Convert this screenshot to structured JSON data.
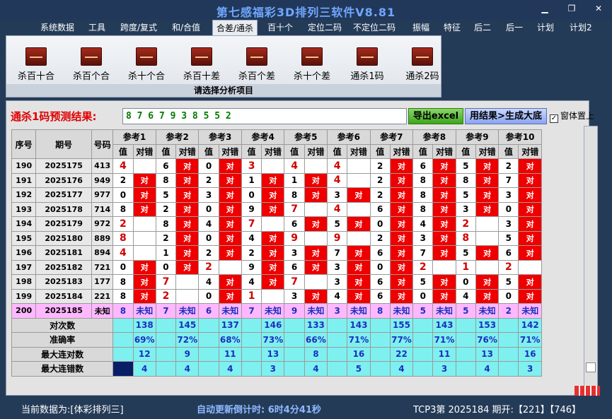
{
  "window": {
    "title": "第七感福彩3D排列三软件V8.81"
  },
  "menu": [
    "系统数据",
    "工具",
    "跨度/复式",
    "和/合值",
    "合差/通杀",
    "百十个",
    "定位二码",
    "不定位二码",
    "振幅",
    "特征",
    "后二",
    "后一",
    "计划",
    "计划2"
  ],
  "menu_active_index": 4,
  "ribbon": {
    "buttons": [
      "杀百十合",
      "杀百个合",
      "杀十个合",
      "杀百十差",
      "杀百个差",
      "杀十个差",
      "通杀1码",
      "通杀2码"
    ],
    "caption": "请选择分析项目"
  },
  "prediction": {
    "label": "通杀1码预测结果:",
    "value": "8 7 6 7 9 3 8 5 5 2"
  },
  "buttons": {
    "excel": "导出excel",
    "generate": "用结果>生成大底",
    "ontop": "窗体置上",
    "ontop_checked": "✓"
  },
  "table": {
    "headers": {
      "seq": "序号",
      "period": "期号",
      "number": "号码",
      "val": "值",
      "result": "对错"
    },
    "refs": [
      "参考1",
      "参考2",
      "参考3",
      "参考4",
      "参考5",
      "参考6",
      "参考7",
      "参考8",
      "参考9",
      "参考10"
    ],
    "rows": [
      {
        "seq": "190",
        "period": "2025175",
        "num": "413",
        "cells": [
          [
            "4",
            0
          ],
          [
            "6",
            1
          ],
          [
            "0",
            1
          ],
          [
            "3",
            0
          ],
          [
            "4",
            0
          ],
          [
            "4",
            0
          ],
          [
            "2",
            1
          ],
          [
            "6",
            1
          ],
          [
            "5",
            1
          ],
          [
            "2",
            1
          ]
        ]
      },
      {
        "seq": "191",
        "period": "2025176",
        "num": "949",
        "cells": [
          [
            "2",
            1
          ],
          [
            "8",
            1
          ],
          [
            "2",
            1
          ],
          [
            "1",
            1
          ],
          [
            "1",
            1
          ],
          [
            "4",
            0
          ],
          [
            "2",
            1
          ],
          [
            "8",
            1
          ],
          [
            "8",
            1
          ],
          [
            "7",
            1
          ]
        ]
      },
      {
        "seq": "192",
        "period": "2025177",
        "num": "977",
        "cells": [
          [
            "0",
            1
          ],
          [
            "5",
            1
          ],
          [
            "3",
            1
          ],
          [
            "0",
            1
          ],
          [
            "8",
            1
          ],
          [
            "3",
            1
          ],
          [
            "2",
            1
          ],
          [
            "8",
            1
          ],
          [
            "5",
            1
          ],
          [
            "3",
            1
          ]
        ]
      },
      {
        "seq": "193",
        "period": "2025178",
        "num": "714",
        "cells": [
          [
            "8",
            1
          ],
          [
            "2",
            1
          ],
          [
            "0",
            1
          ],
          [
            "9",
            1
          ],
          [
            "7",
            0
          ],
          [
            "4",
            0
          ],
          [
            "6",
            1
          ],
          [
            "8",
            1
          ],
          [
            "3",
            1
          ],
          [
            "0",
            1
          ]
        ]
      },
      {
        "seq": "194",
        "period": "2025179",
        "num": "972",
        "cells": [
          [
            "2",
            0
          ],
          [
            "8",
            1
          ],
          [
            "4",
            1
          ],
          [
            "7",
            0
          ],
          [
            "6",
            1
          ],
          [
            "5",
            1
          ],
          [
            "0",
            1
          ],
          [
            "4",
            1
          ],
          [
            "2",
            0
          ],
          [
            "3",
            1
          ]
        ]
      },
      {
        "seq": "195",
        "period": "2025180",
        "num": "889",
        "cells": [
          [
            "8",
            0
          ],
          [
            "2",
            1
          ],
          [
            "0",
            1
          ],
          [
            "4",
            1
          ],
          [
            "9",
            0
          ],
          [
            "9",
            0
          ],
          [
            "2",
            1
          ],
          [
            "3",
            1
          ],
          [
            "8",
            0
          ],
          [
            "5",
            1
          ]
        ]
      },
      {
        "seq": "196",
        "period": "2025181",
        "num": "894",
        "cells": [
          [
            "4",
            0
          ],
          [
            "1",
            1
          ],
          [
            "2",
            1
          ],
          [
            "2",
            1
          ],
          [
            "3",
            1
          ],
          [
            "7",
            1
          ],
          [
            "6",
            1
          ],
          [
            "7",
            1
          ],
          [
            "5",
            1
          ],
          [
            "6",
            1
          ]
        ]
      },
      {
        "seq": "197",
        "period": "2025182",
        "num": "721",
        "cells": [
          [
            "0",
            1
          ],
          [
            "0",
            1
          ],
          [
            "2",
            0
          ],
          [
            "9",
            1
          ],
          [
            "6",
            1
          ],
          [
            "3",
            1
          ],
          [
            "0",
            1
          ],
          [
            "2",
            0
          ],
          [
            "1",
            0
          ],
          [
            "2",
            0
          ]
        ]
      },
      {
        "seq": "198",
        "period": "2025183",
        "num": "177",
        "cells": [
          [
            "8",
            1
          ],
          [
            "7",
            0
          ],
          [
            "4",
            1
          ],
          [
            "4",
            1
          ],
          [
            "7",
            0
          ],
          [
            "3",
            1
          ],
          [
            "6",
            1
          ],
          [
            "5",
            1
          ],
          [
            "0",
            1
          ],
          [
            "5",
            1
          ]
        ]
      },
      {
        "seq": "199",
        "period": "2025184",
        "num": "221",
        "cells": [
          [
            "8",
            1
          ],
          [
            "2",
            0
          ],
          [
            "0",
            1
          ],
          [
            "1",
            0
          ],
          [
            "3",
            1
          ],
          [
            "4",
            1
          ],
          [
            "6",
            1
          ],
          [
            "0",
            1
          ],
          [
            "4",
            1
          ],
          [
            "0",
            1
          ]
        ]
      }
    ],
    "pending": {
      "seq": "200",
      "period": "2025185",
      "num": "未知",
      "values": [
        "8",
        "7",
        "6",
        "7",
        "9",
        "3",
        "8",
        "5",
        "5",
        "2"
      ],
      "result": "未知"
    },
    "red_cell_text": "对",
    "stats": [
      {
        "label": "对次数",
        "values": [
          "138",
          "145",
          "137",
          "146",
          "133",
          "143",
          "155",
          "143",
          "153",
          "142"
        ]
      },
      {
        "label": "准确率",
        "values": [
          "69%",
          "72%",
          "68%",
          "73%",
          "66%",
          "71%",
          "77%",
          "71%",
          "76%",
          "71%"
        ]
      },
      {
        "label": "最大连对数",
        "values": [
          "12",
          "9",
          "11",
          "13",
          "8",
          "16",
          "22",
          "11",
          "13",
          "16"
        ]
      },
      {
        "label": "最大连错数",
        "values": [
          "4",
          "4",
          "4",
          "3",
          "4",
          "5",
          "4",
          "3",
          "4",
          "3"
        ]
      }
    ]
  },
  "status": {
    "current": "当前数据为:[体彩排列三]",
    "countdown": "自动更新倒计时: 6时4分41秒",
    "tcp": "TCP3第 2025184 期开:【221】【746】"
  },
  "colors": {
    "accent_red": "#ef0000",
    "pending": "#ffb8ff",
    "stat": "#7ff0f0",
    "title": "#6fa8ff"
  }
}
